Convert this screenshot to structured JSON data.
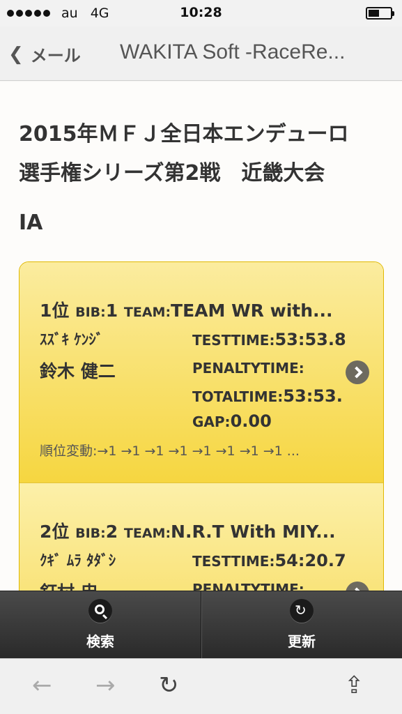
{
  "status_bar": {
    "carrier": "au",
    "network": "4G",
    "time": "10:28"
  },
  "nav": {
    "back_label": "メール",
    "title": "WAKITA Soft -RaceRe..."
  },
  "page": {
    "event_title_line1": "2015年ＭＦＪ全日本エンデューロ",
    "event_title_line2": "選手権シリーズ第2戦　近畿大会",
    "class_name": "IA"
  },
  "results": [
    {
      "position": "1位",
      "bib_label": "BIB:",
      "bib": "1",
      "team_label": "TEAM:",
      "team": "TEAM WR with...",
      "name_kana": "ｽｽﾞｷ ｹﾝｼﾞ",
      "name_kanji": "鈴木 健二",
      "testtime_label": "TESTTIME:",
      "testtime": "53:53.8",
      "penalty_label": "PENALTYTIME:",
      "penalty": "",
      "totaltime_label": "TOTALTIME:",
      "totaltime": "53:53.",
      "gap_label": "GAP:",
      "gap": "0.00",
      "rank_change": "順位変動:→1 →1 →1 →1 →1 →1 →1 →1 ..."
    },
    {
      "position": "2位",
      "bib_label": "BIB:",
      "bib": "2",
      "team_label": "TEAM:",
      "team": "N.R.T With MIY...",
      "name_kana": "ｸｷﾞ ﾑﾗ ﾀﾀﾞｼ",
      "name_kanji": "釘村 忠",
      "testtime_label": "TESTTIME:",
      "testtime": "54:20.7",
      "penalty_label": "PENALTYTIME:",
      "penalty": ""
    }
  ],
  "toolbar": {
    "search_label": "検索",
    "refresh_label": "更新"
  },
  "icons": {
    "back": "chevron-left-icon",
    "search": "search-icon",
    "refresh": "refresh-icon",
    "browser_back": "arrow-left-icon",
    "browser_forward": "arrow-right-icon",
    "browser_reload": "reload-icon",
    "share": "share-icon"
  }
}
